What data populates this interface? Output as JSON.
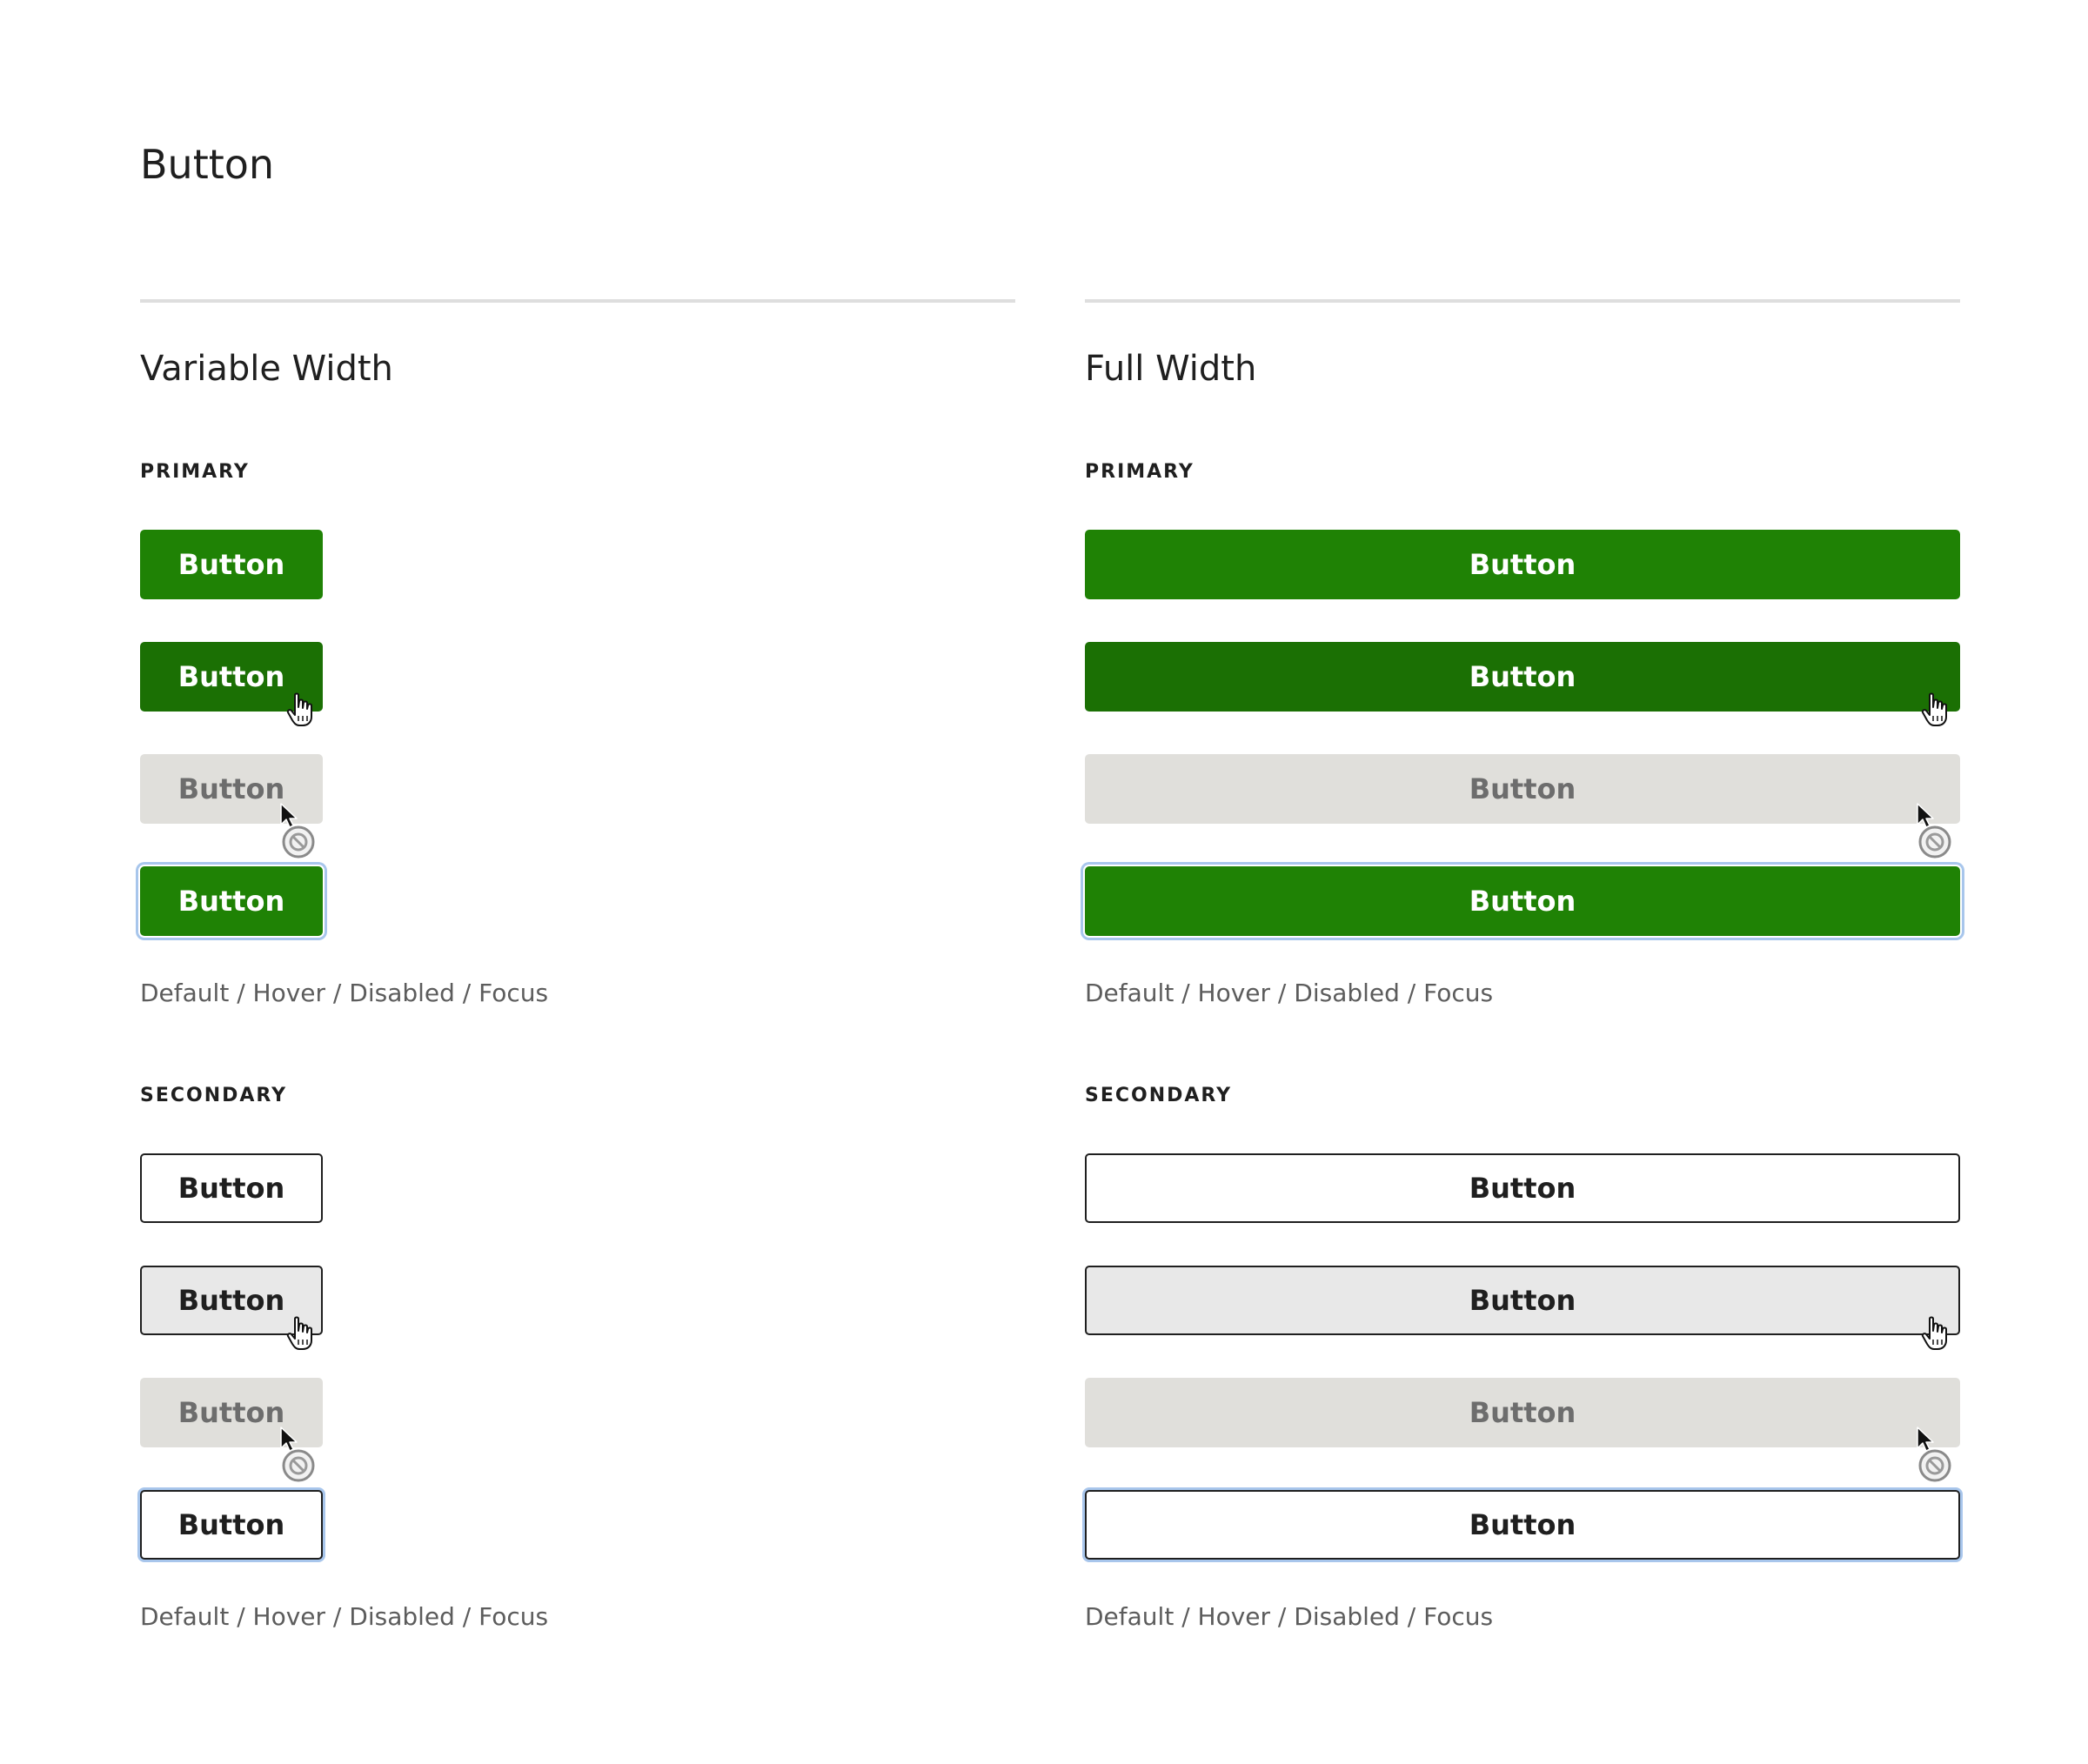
{
  "page": {
    "title": "Button"
  },
  "columns": [
    {
      "heading": "Variable Width",
      "primary": {
        "label": "PRIMARY",
        "buttons": [
          "Button",
          "Button",
          "Button",
          "Button"
        ],
        "caption": "Default / Hover / Disabled / Focus"
      },
      "secondary": {
        "label": "SECONDARY",
        "buttons": [
          "Button",
          "Button",
          "Button",
          "Button"
        ],
        "caption": "Default / Hover / Disabled / Focus"
      }
    },
    {
      "heading": "Full Width",
      "primary": {
        "label": "PRIMARY",
        "buttons": [
          "Button",
          "Button",
          "Button",
          "Button"
        ],
        "caption": "Default / Hover / Disabled / Focus"
      },
      "secondary": {
        "label": "SECONDARY",
        "buttons": [
          "Button",
          "Button",
          "Button",
          "Button"
        ],
        "caption": "Default / Hover / Disabled / Focus"
      }
    }
  ],
  "colors": {
    "primary": "#1f8205",
    "primary_hover": "#1b7004",
    "disabled_bg": "#e0dfdb",
    "disabled_text": "#6d6d6d",
    "focus_ring": "#a8c6ec",
    "secondary_hover_bg": "#e8e8e8",
    "text": "#1f1f1f",
    "caption_text": "#5c5c5c",
    "rule": "#dedede"
  },
  "icons": {
    "hover_cursor": "hand-pointer-icon",
    "disabled_cursor": "not-allowed-cursor-icon"
  }
}
